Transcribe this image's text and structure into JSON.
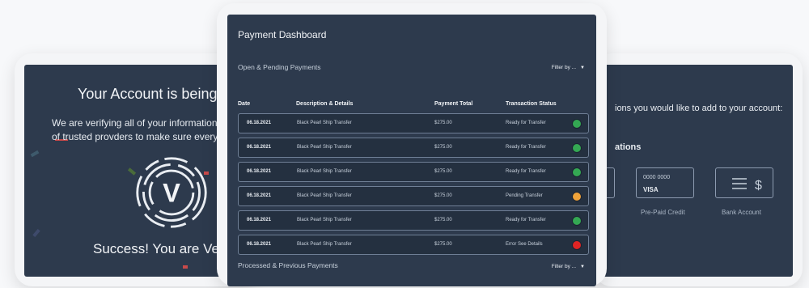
{
  "left_panel": {
    "title": "Your Account is being V",
    "verify_lines": [
      "We are verifying all of your information",
      "of trusted provders to make sure every"
    ],
    "logo_letter": "V",
    "success": "Success! You are Ver"
  },
  "right_panel": {
    "prompt": "ions you would like to add to your account:",
    "section": "ations",
    "visa_number": "0000 0000",
    "visa_brand": "VISA",
    "bank_icon": "$",
    "prepaid_label": "Pre-Paid Credit",
    "bank_label": "Bank Account"
  },
  "dashboard": {
    "title": "Payment Dashboard",
    "open_section": "Open & Pending Payments",
    "processed_section": "Processed & Previous Payments",
    "filter_label": "Filter by ...",
    "headers": {
      "date": "Date",
      "description": "Description & Details",
      "total": "Payment Total",
      "status": "Transaction Status"
    },
    "rows": [
      {
        "date": "06.18.2021",
        "description": "Black Pearl Ship Transfer",
        "total": "$275.00",
        "status": "Ready for Transfer",
        "dot": "#34a853"
      },
      {
        "date": "06.18.2021",
        "description": "Black Pearl Ship Transfer",
        "total": "$275.00",
        "status": "Ready for Transfer",
        "dot": "#34a853"
      },
      {
        "date": "06.18.2021",
        "description": "Black Pearl Ship Transfer",
        "total": "$275.00",
        "status": "Ready for Transfer",
        "dot": "#34a853"
      },
      {
        "date": "06.18.2021",
        "description": "Black Pearl Ship Transfer",
        "total": "$275.00",
        "status": "Pending Transfer",
        "dot": "#f0a33a"
      },
      {
        "date": "06.18.2021",
        "description": "Black Pearl Ship Transfer",
        "total": "$275.00",
        "status": "Ready for Transfer",
        "dot": "#34a853"
      },
      {
        "date": "06.18.2021",
        "description": "Black Pearl Ship Transfer",
        "total": "$275.00",
        "status": "Error See Details",
        "dot": "#e02424"
      }
    ]
  },
  "colors": {
    "screen_bg": "#2d3a4d",
    "frame": "#f4f5f7",
    "status_ok": "#34a853",
    "status_pending": "#f0a33a",
    "status_error": "#e02424"
  }
}
